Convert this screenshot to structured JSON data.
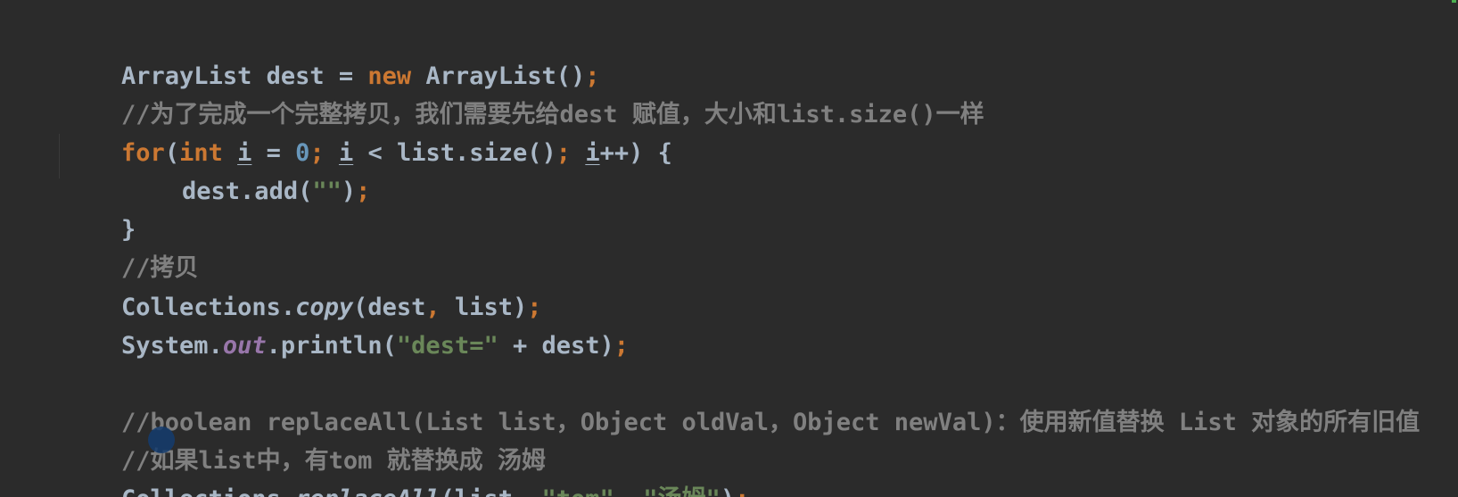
{
  "code": {
    "l1": {
      "a": "ArrayList dest = ",
      "b": "new",
      "c": " ArrayList()",
      "d": ";"
    },
    "l2": {
      "text": "//为了完成一个完整拷贝，我们需要先给dest 赋值，大小和list.size()一样"
    },
    "l3": {
      "a": "for",
      "b": "(",
      "c": "int",
      "d": " ",
      "e": "i",
      "f": " = ",
      "g": "0",
      "h": "; ",
      "i": "i",
      "j": " < list.size()",
      "k": "; ",
      "l": "i",
      "m": "++) {"
    },
    "l4": {
      "a": "dest.add(",
      "b": "\"\"",
      "c": ")",
      "d": ";"
    },
    "l5": {
      "text": "}"
    },
    "l6": {
      "text": "//拷贝"
    },
    "l7": {
      "a": "Collections.",
      "b": "copy",
      "c": "(dest",
      "d": ",",
      "e": " list)",
      "f": ";"
    },
    "l8": {
      "a": "System.",
      "b": "out",
      "c": ".println(",
      "d": "\"dest=\"",
      "e": " + dest)",
      "f": ";"
    },
    "l10": {
      "text": "//boolean replaceAll(List list，Object oldVal，Object newVal)：使用新值替换 List 对象的所有旧值"
    },
    "l11": {
      "text": "//如果list中，有tom 就替换成 汤姆"
    },
    "l12": {
      "a": "Collections.",
      "b": "replaceAll",
      "c": "(list",
      "d": ",",
      "e": " ",
      "f": "\"tom\"",
      "g": ",",
      "h": " ",
      "i": "\"汤姆\"",
      "j": ")",
      "k": ";"
    }
  },
  "colors": {
    "background": "#2b2b2b",
    "default_text": "#a9b7c6",
    "keyword": "#cc7832",
    "number": "#6897bb",
    "string": "#6a8759",
    "comment": "#808080",
    "static_field": "#9876aa"
  }
}
